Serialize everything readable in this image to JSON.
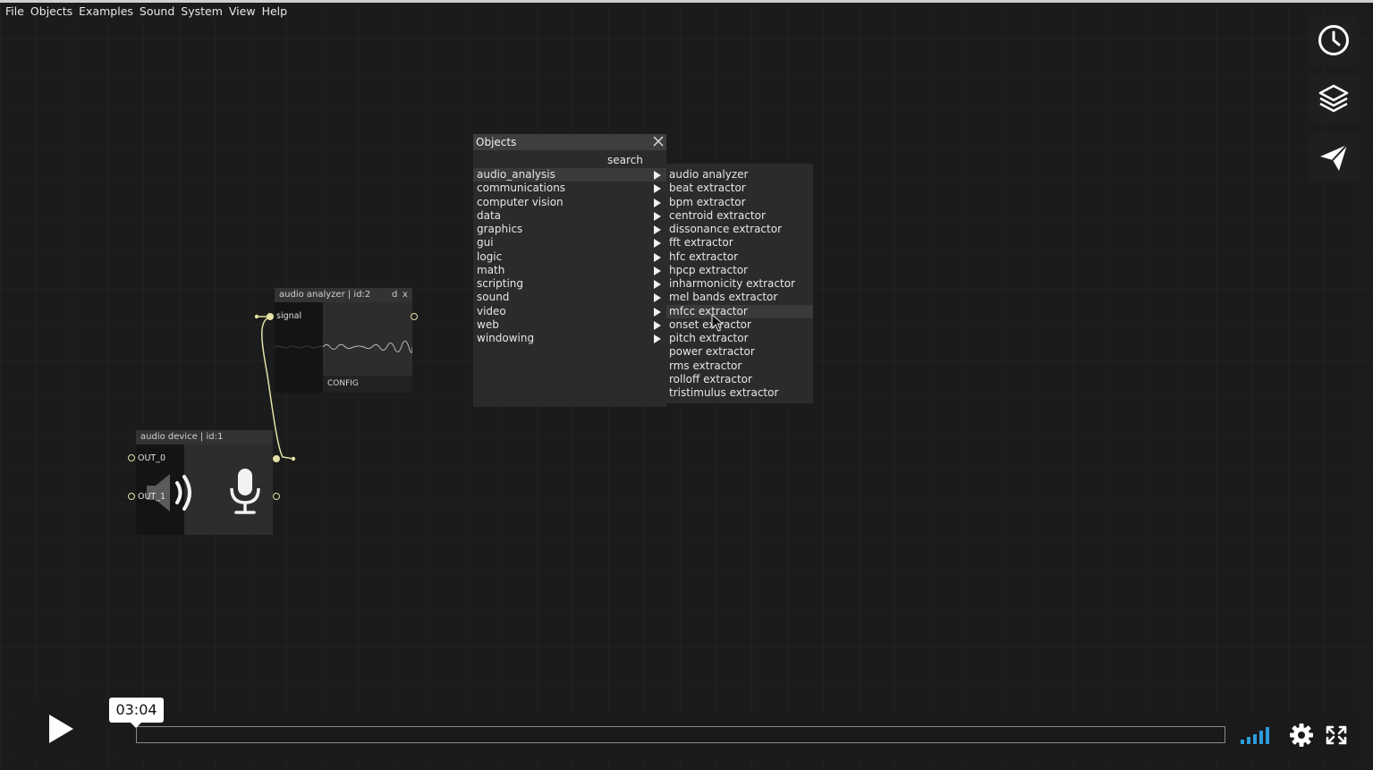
{
  "menubar": {
    "items": [
      "File",
      "Objects",
      "Examples",
      "Sound",
      "System",
      "View",
      "Help"
    ]
  },
  "side_buttons": [
    {
      "icon": "clock-icon"
    },
    {
      "icon": "layers-icon"
    },
    {
      "icon": "send-icon"
    }
  ],
  "audio_analyzer": {
    "title": "audio analyzer | id:2",
    "btn_d": "d",
    "btn_x": "x",
    "inlet_label": "signal",
    "config_label": "CONFIG"
  },
  "audio_device": {
    "title": "audio device | id:1",
    "outlets": [
      "OUT_0",
      "OUT_1"
    ]
  },
  "objects_dialog": {
    "title": "Objects",
    "search_label": "search",
    "selected_category": "audio_analysis",
    "categories": [
      "audio_analysis",
      "communications",
      "computer vision",
      "data",
      "graphics",
      "gui",
      "logic",
      "math",
      "scripting",
      "sound",
      "video",
      "web",
      "windowing"
    ],
    "submenu_items": [
      "audio analyzer",
      "beat extractor",
      "bpm extractor",
      "centroid extractor",
      "dissonance extractor",
      "fft extractor",
      "hfc extractor",
      "hpcp extractor",
      "inharmonicity extractor",
      "mel bands extractor",
      "mfcc extractor",
      "onset extractor",
      "pitch extractor",
      "power extractor",
      "rms extractor",
      "rolloff extractor",
      "tristimulus extractor"
    ],
    "hovered_item": "mfcc extractor"
  },
  "video_player": {
    "time_tooltip": "03:04",
    "colors": {
      "volume": "#2d9cdb",
      "cable": "#e3e1a6"
    }
  }
}
